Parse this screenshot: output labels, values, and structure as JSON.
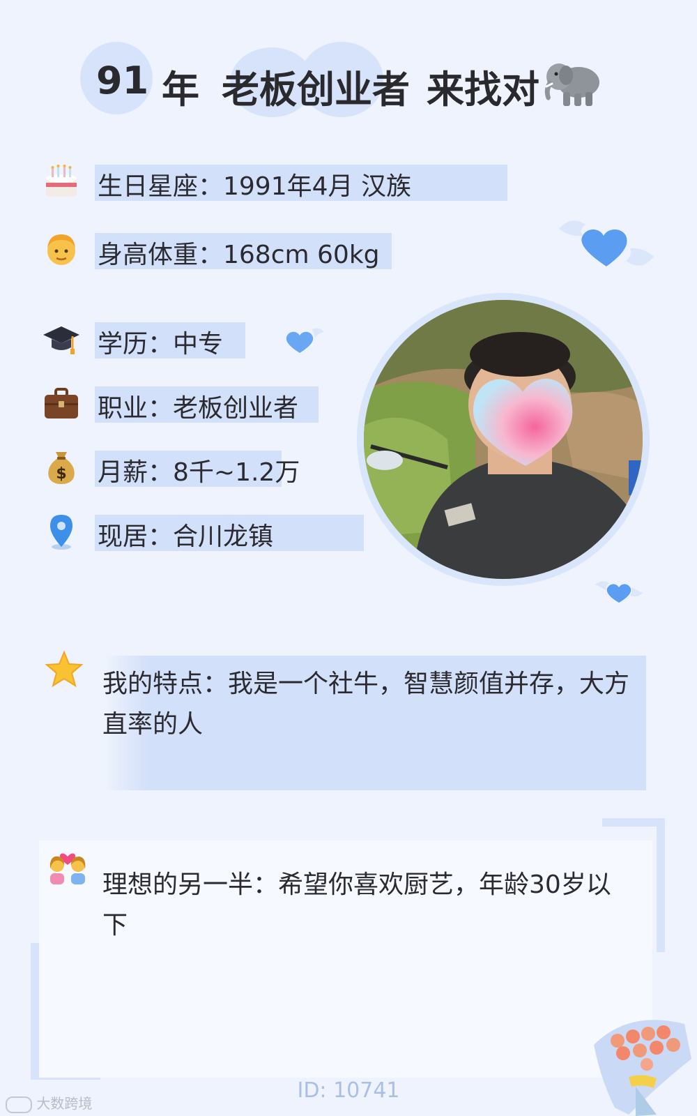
{
  "title": {
    "age": "91",
    "year_suffix": "年",
    "occupation": "老板创业者",
    "seeking": "来找对",
    "emoji_icon": "elephant-icon"
  },
  "info": [
    {
      "icon": "birthday-cake-icon",
      "text": "生日星座：1991年4月 汉族"
    },
    {
      "icon": "man-face-icon",
      "text": "身高体重：168cm 60kg"
    },
    {
      "icon": "graduation-cap-icon",
      "text": "学历：中专"
    },
    {
      "icon": "briefcase-icon",
      "text": "职业：老板创业者"
    },
    {
      "icon": "money-bag-icon",
      "text": "月薪：8千~1.2万"
    },
    {
      "icon": "location-pin-icon",
      "text": "现居：合川龙镇"
    }
  ],
  "feature": {
    "icon": "star-icon",
    "text": "我的特点：我是一个社牛，智慧颜值并存，大方直率的人"
  },
  "ideal": {
    "icon": "couple-heart-icon",
    "text": "理想的另一半：希望你喜欢厨艺，年龄30岁以下"
  },
  "footer": {
    "id": "ID: 10741",
    "watermark": "大数跨境"
  },
  "colors": {
    "background": "#eef3fd",
    "accent_band": "#d3e0fa",
    "heart_blue": "#5b9df0",
    "id_text": "#a9bfe6"
  }
}
